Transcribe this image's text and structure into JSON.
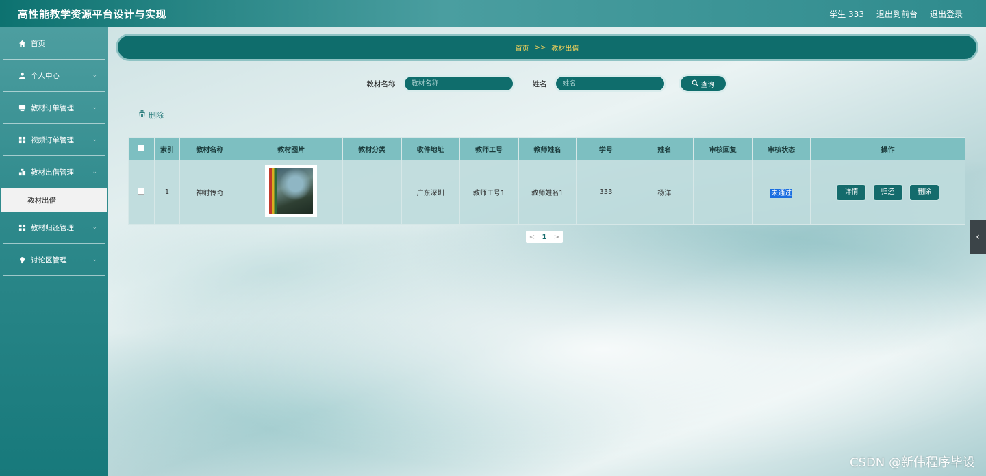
{
  "header": {
    "title": "高性能教学资源平台设计与实现",
    "user": "学生 333",
    "front_label": "退出到前台",
    "logout_label": "退出登录"
  },
  "sidebar": {
    "items": [
      {
        "label": "首页",
        "icon": "home-icon"
      },
      {
        "label": "个人中心",
        "icon": "user-icon"
      },
      {
        "label": "教材订单管理",
        "icon": "order-icon"
      },
      {
        "label": "视频订单管理",
        "icon": "grid-icon"
      },
      {
        "label": "教材出借管理",
        "icon": "lend-icon"
      },
      {
        "label": "教材归还管理",
        "icon": "grid-icon"
      },
      {
        "label": "讨论区管理",
        "icon": "bulb-icon"
      }
    ],
    "active_sub": "教材出借"
  },
  "breadcrumb": {
    "home": "首页",
    "sep": ">>",
    "current": "教材出借"
  },
  "search": {
    "field1_label": "教材名称",
    "field1_placeholder": "教材名称",
    "field2_label": "姓名",
    "field2_placeholder": "姓名",
    "query_label": "查询"
  },
  "actions": {
    "delete_label": "删除"
  },
  "table": {
    "headers": [
      "索引",
      "教材名称",
      "教材图片",
      "教材分类",
      "收件地址",
      "教师工号",
      "教师姓名",
      "学号",
      "姓名",
      "审核回复",
      "审核状态",
      "操作"
    ],
    "rows": [
      {
        "index": "1",
        "name": "神射传奇",
        "category": "",
        "address": "广东深圳",
        "teacher_id": "教师工号1",
        "teacher_name": "教师姓名1",
        "student_id": "333",
        "student_name": "杨洋",
        "reply": "",
        "status": "未通过",
        "ops": [
          "详情",
          "归还",
          "删除"
        ]
      }
    ]
  },
  "pagination": {
    "prev": "<",
    "current": "1",
    "next": ">"
  },
  "watermark": "CSDN @新伟程序毕设",
  "colors": {
    "primary": "#0f6d6c",
    "accent": "#f4d25a",
    "status_tag": "#1a6ee0"
  }
}
